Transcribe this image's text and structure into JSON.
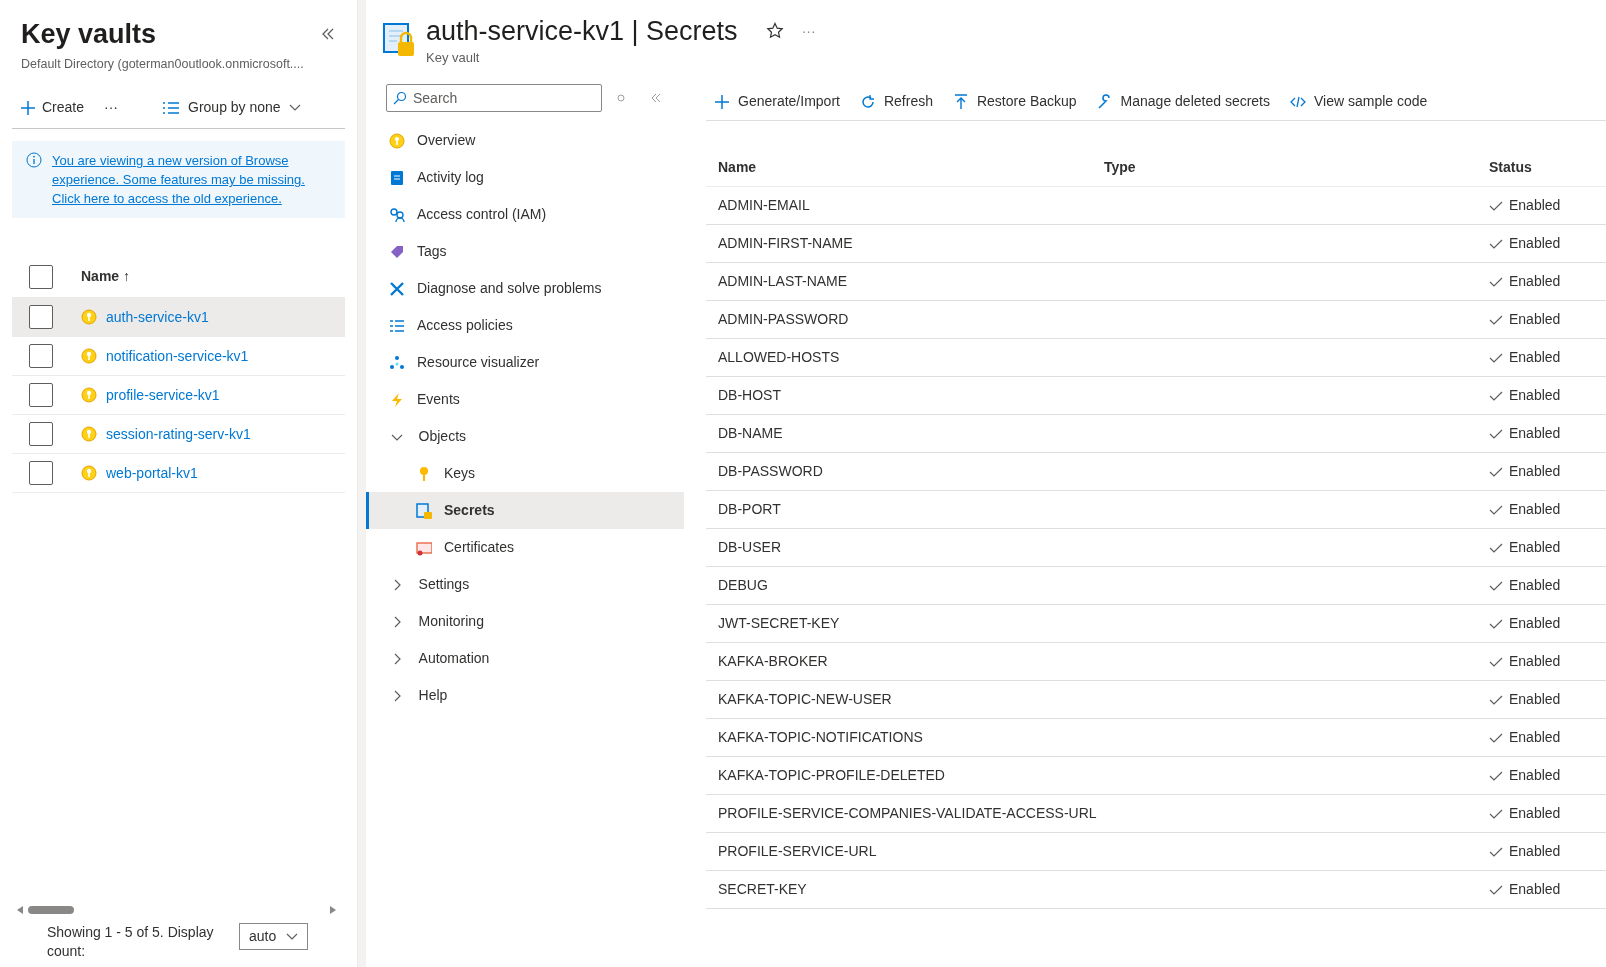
{
  "left_pane": {
    "title": "Key vaults",
    "subtitle": "Default Directory (goterman0outlook.onmicrosoft....",
    "toolbar": {
      "create": "Create",
      "more": "···",
      "group_by": "Group by none"
    },
    "banner": "You are viewing a new version of Browse experience. Some features may be missing. Click here to access the old experience.",
    "list": {
      "column": "Name ↑",
      "all_checked": false,
      "rows": [
        {
          "name": "auth-service-kv1",
          "selected": true,
          "checked": false
        },
        {
          "name": "notification-service-kv1",
          "selected": false,
          "checked": false
        },
        {
          "name": "profile-service-kv1",
          "selected": false,
          "checked": false
        },
        {
          "name": "session-rating-serv-kv1",
          "selected": false,
          "checked": false
        },
        {
          "name": "web-portal-kv1",
          "selected": false,
          "checked": false
        }
      ]
    },
    "footer": {
      "text": "Showing 1 - 5 of 5. Display count:",
      "count": "auto"
    }
  },
  "resource": {
    "title": "auth-service-kv1 | Secrets",
    "subtitle": "Key vault",
    "more": "···"
  },
  "nav": {
    "search": {
      "placeholder": "Search"
    },
    "items": [
      {
        "label": "Overview",
        "selected": false
      },
      {
        "label": "Activity log",
        "selected": false
      },
      {
        "label": "Access control (IAM)",
        "selected": false
      },
      {
        "label": "Tags",
        "selected": false
      },
      {
        "label": "Diagnose and solve problems",
        "selected": false
      },
      {
        "label": "Access policies",
        "selected": false
      },
      {
        "label": "Resource visualizer",
        "selected": false
      },
      {
        "label": "Events",
        "selected": false
      },
      {
        "label": "Objects",
        "expanded": true,
        "children": [
          {
            "label": "Keys",
            "selected": false
          },
          {
            "label": "Secrets",
            "selected": true
          },
          {
            "label": "Certificates",
            "selected": false
          }
        ]
      },
      {
        "label": "Settings",
        "expanded": false
      },
      {
        "label": "Monitoring",
        "expanded": false
      },
      {
        "label": "Automation",
        "expanded": false
      },
      {
        "label": "Help",
        "expanded": false
      }
    ]
  },
  "toolbar": [
    "Generate/Import",
    "Refresh",
    "Restore Backup",
    "Manage deleted secrets",
    "View sample code"
  ],
  "table": {
    "columns": [
      "Name",
      "Type",
      "Status"
    ],
    "rows": [
      {
        "name": "ADMIN-EMAIL",
        "status": "Enabled"
      },
      {
        "name": "ADMIN-FIRST-NAME",
        "status": "Enabled"
      },
      {
        "name": "ADMIN-LAST-NAME",
        "status": "Enabled"
      },
      {
        "name": "ADMIN-PASSWORD",
        "status": "Enabled"
      },
      {
        "name": "ALLOWED-HOSTS",
        "status": "Enabled"
      },
      {
        "name": "DB-HOST",
        "status": "Enabled"
      },
      {
        "name": "DB-NAME",
        "status": "Enabled"
      },
      {
        "name": "DB-PASSWORD",
        "status": "Enabled"
      },
      {
        "name": "DB-PORT",
        "status": "Enabled"
      },
      {
        "name": "DB-USER",
        "status": "Enabled"
      },
      {
        "name": "DEBUG",
        "status": "Enabled"
      },
      {
        "name": "JWT-SECRET-KEY",
        "status": "Enabled"
      },
      {
        "name": "KAFKA-BROKER",
        "status": "Enabled"
      },
      {
        "name": "KAFKA-TOPIC-NEW-USER",
        "status": "Enabled"
      },
      {
        "name": "KAFKA-TOPIC-NOTIFICATIONS",
        "status": "Enabled"
      },
      {
        "name": "KAFKA-TOPIC-PROFILE-DELETED",
        "status": "Enabled"
      },
      {
        "name": "PROFILE-SERVICE-COMPANIES-VALIDATE-ACCESS-URL",
        "status": "Enabled"
      },
      {
        "name": "PROFILE-SERVICE-URL",
        "status": "Enabled"
      },
      {
        "name": "SECRET-KEY",
        "status": "Enabled"
      }
    ]
  }
}
